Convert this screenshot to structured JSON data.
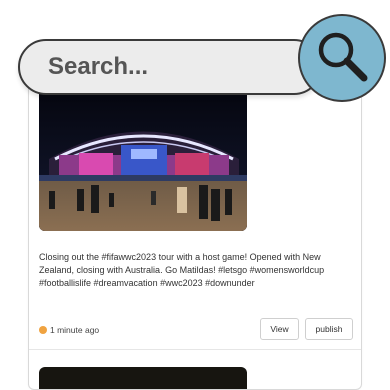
{
  "search": {
    "placeholder": "Search...",
    "icon": "search-icon"
  },
  "post": {
    "caption": "Closing out the #fifawwc2023 tour with a host game! Opened with New Zealand, closing with Australia. Go Matildas! #letsgo #womensworldcup #footballislife #dreamvacation #wwc2023 #downunder",
    "time": "1 minute ago",
    "view_label": "View",
    "publish_label": "publish"
  },
  "colors": {
    "accent": "#7eb7cf",
    "clock": "#f0a340"
  }
}
